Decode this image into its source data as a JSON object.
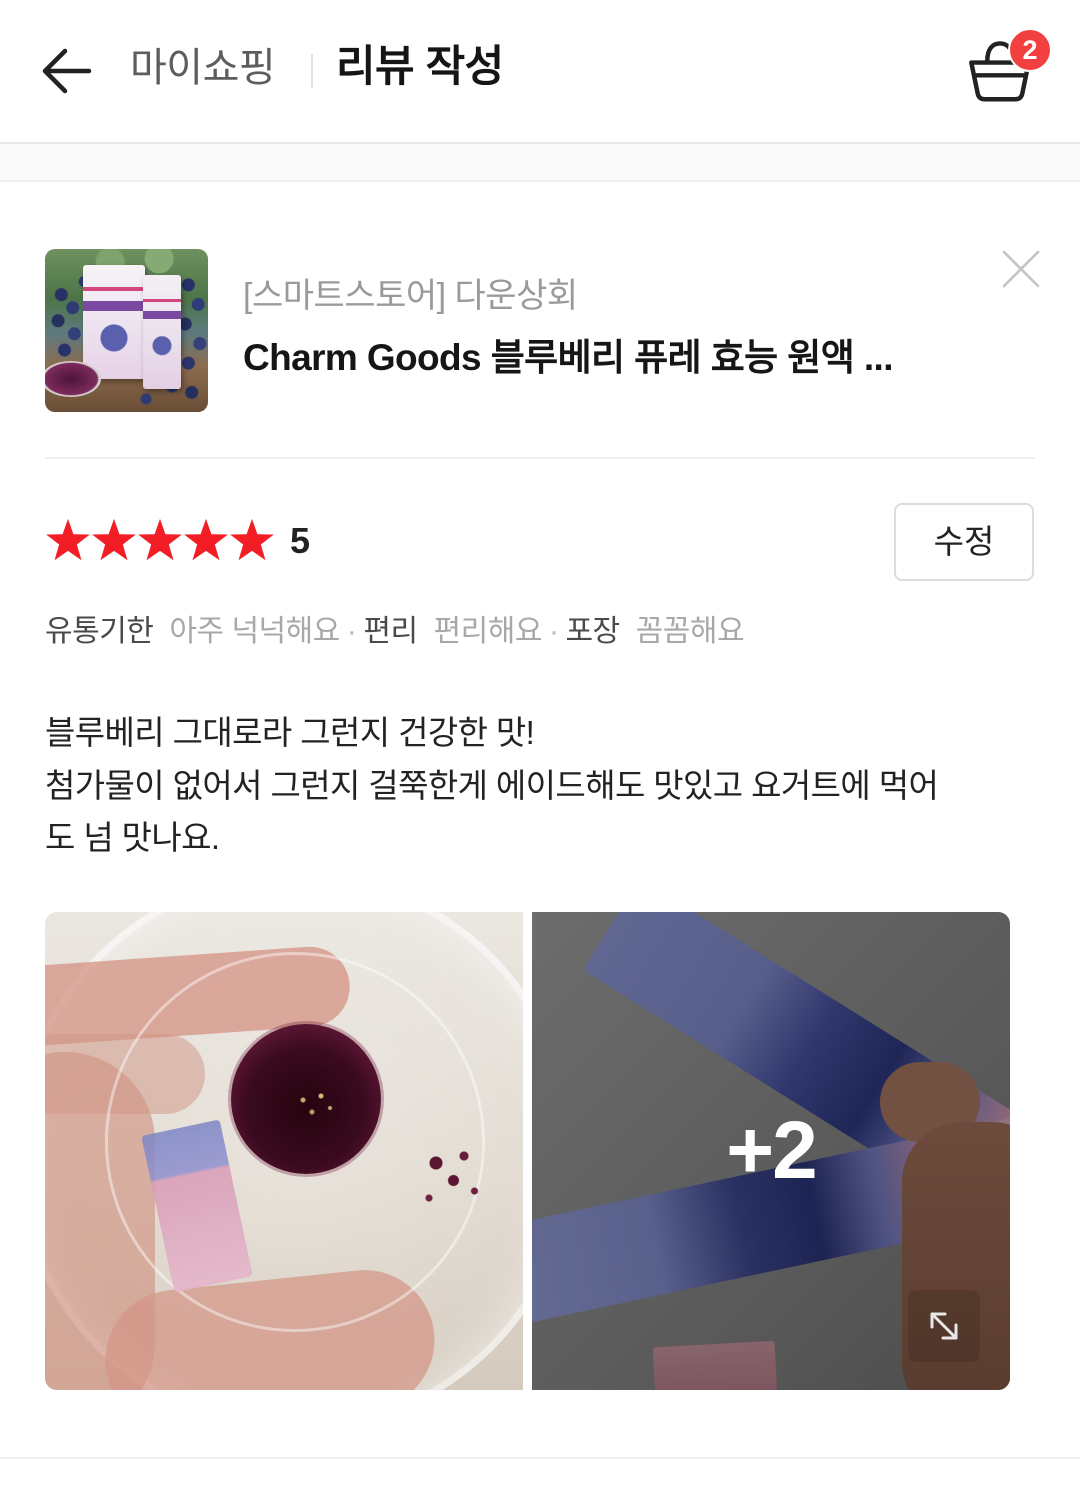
{
  "header": {
    "back_icon": "arrow-left-icon",
    "breadcrumb_parent": "마이쇼핑",
    "title": "리뷰 작성",
    "cart_icon": "cart-icon",
    "cart_count": "2"
  },
  "product": {
    "store": "[스마트스토어] 다운상회",
    "name": "Charm Goods 블루베리 퓨레 효능 원액 ...",
    "close_icon": "close-icon"
  },
  "review": {
    "rating": 5,
    "rating_max": 5,
    "star_icon": "star-icon",
    "edit_label": "수정",
    "tag_separator": "·",
    "tags": [
      {
        "label": "유통기한",
        "value": "아주 넉넉해요"
      },
      {
        "label": "편리",
        "value": "편리해요"
      },
      {
        "label": "포장",
        "value": "꼼꼼해요"
      }
    ],
    "text_lines": [
      "블루베리 그대로라 그런지 건강한 맛!",
      "첨가물이 없어서 그런지 걸쭉한게 에이드해도 맛있고 요거트에 먹어",
      "도 넘 맛나요."
    ],
    "photos": {
      "more_count": "+2",
      "expand_icon": "expand-icon"
    }
  },
  "colors": {
    "star": "#f31d25",
    "badge": "#f23f3f",
    "title_text": "#151515",
    "muted_text": "#9a9a9a",
    "tag_value": "#a8a8a8",
    "border": "#dcdcdc"
  }
}
